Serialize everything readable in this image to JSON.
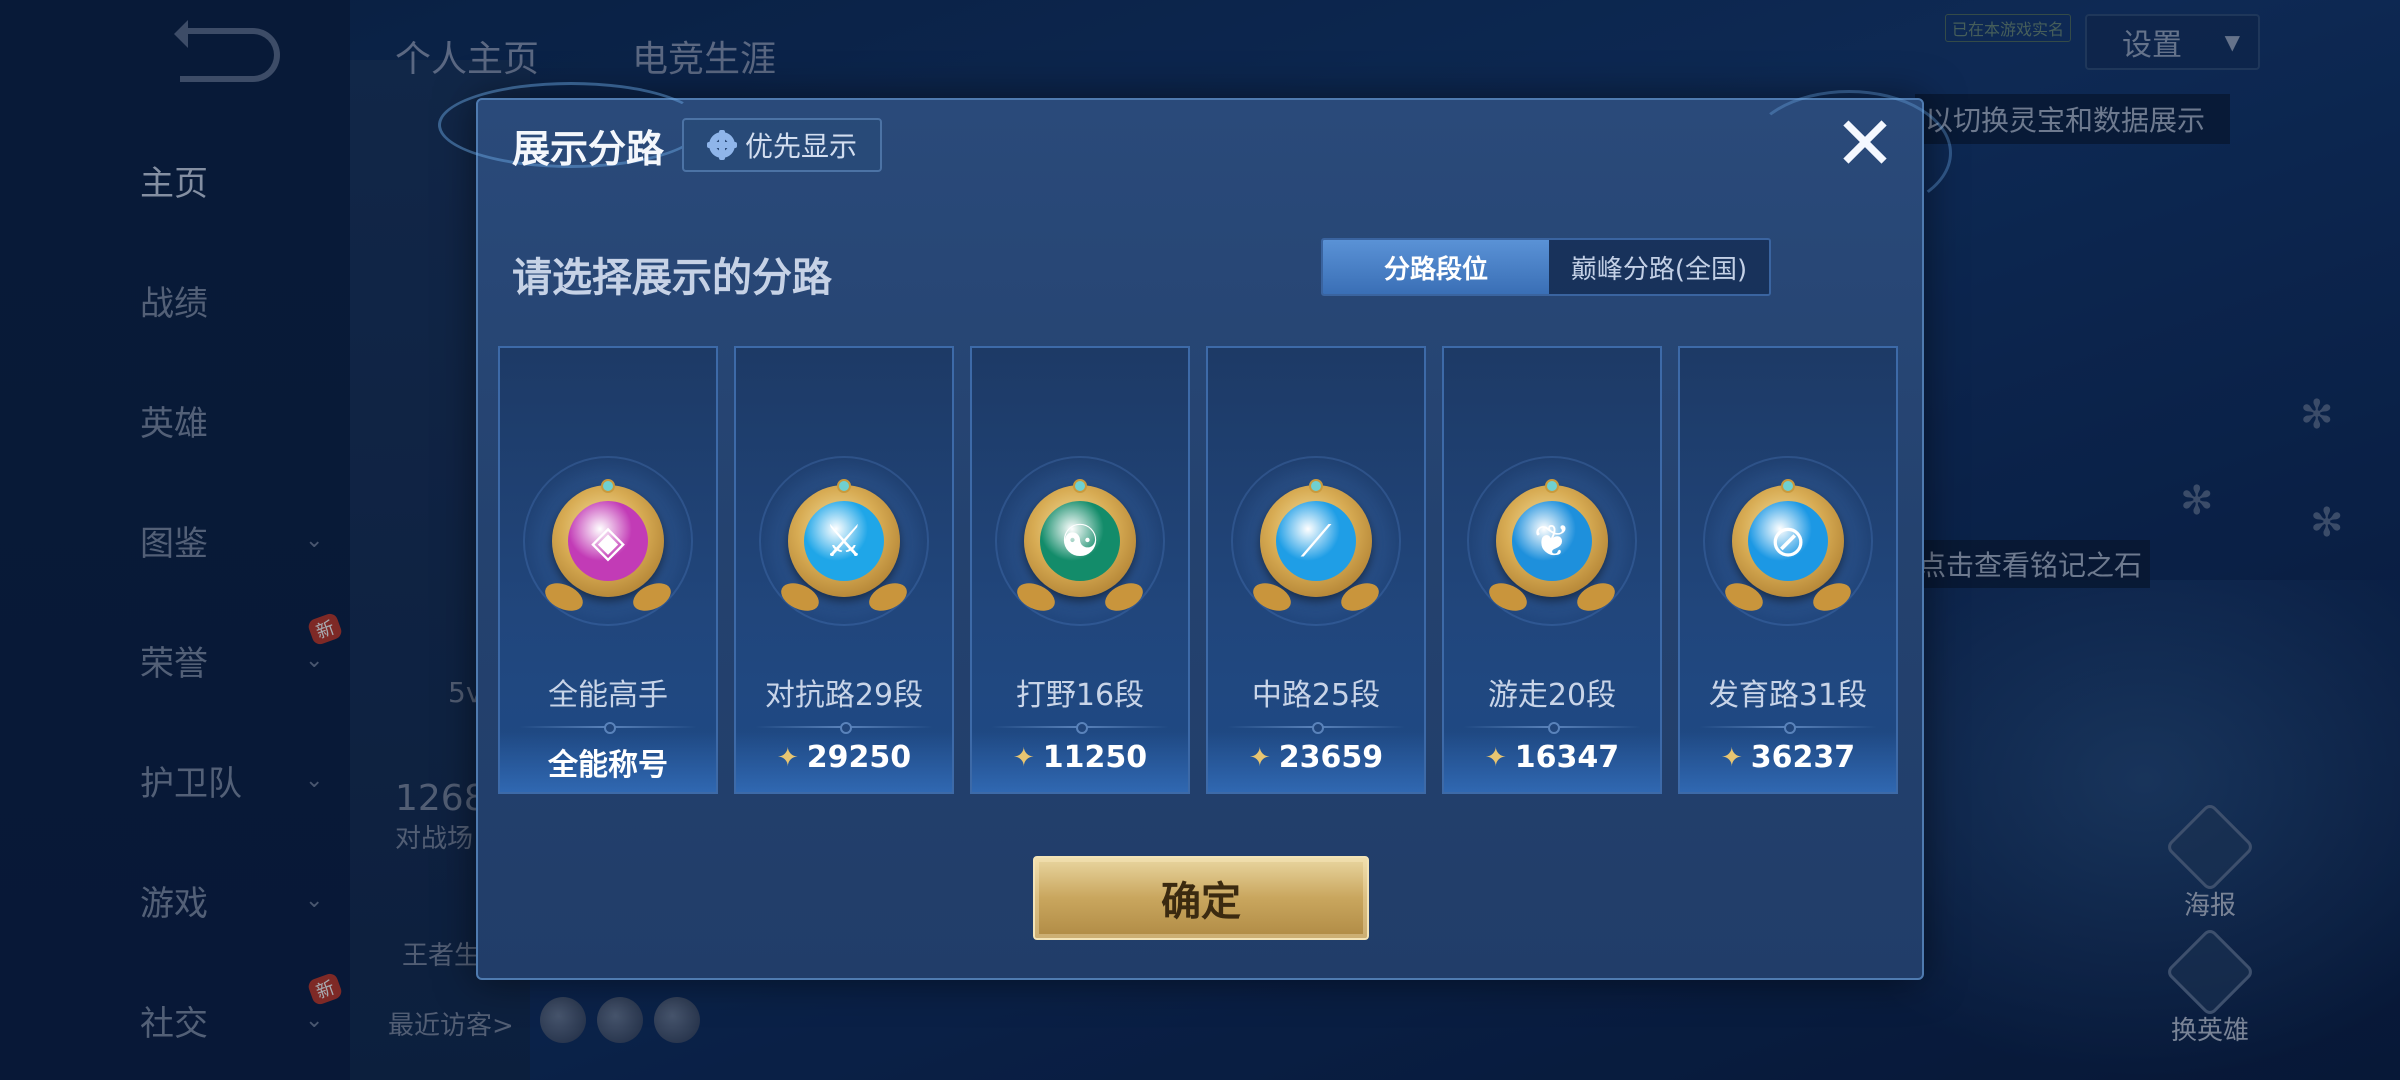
{
  "background": {
    "top_tabs": [
      "个人主页",
      "电竞生涯"
    ],
    "nav_items": [
      {
        "label": "主页",
        "active": true,
        "chevron": false,
        "new": false
      },
      {
        "label": "战绩",
        "active": false,
        "chevron": false,
        "new": false
      },
      {
        "label": "英雄",
        "active": false,
        "chevron": false,
        "new": false
      },
      {
        "label": "图鉴",
        "active": false,
        "chevron": true,
        "new": false
      },
      {
        "label": "荣誉",
        "active": false,
        "chevron": true,
        "new": true
      },
      {
        "label": "护卫队",
        "active": false,
        "chevron": true,
        "new": false
      },
      {
        "label": "游戏",
        "active": false,
        "chevron": true,
        "new": false
      },
      {
        "label": "社交",
        "active": false,
        "chevron": true,
        "new": true
      }
    ],
    "new_badge": "新",
    "settings_label": "设置",
    "small_tag": "已在本游戏实名",
    "tip_top": "以切换灵宝和数据展示",
    "tip_mid": "点击查看铭记之石",
    "stat_number": "1268",
    "stat_label": "对战场",
    "partial_5v": "5v",
    "partial_wangzhe": "王者生",
    "recent_visitors": "最近访客>",
    "right_buttons": [
      "海报",
      "换英雄"
    ]
  },
  "dialog": {
    "title": "展示分路",
    "priority_label": "优先显示",
    "close_symbol": "✕",
    "prompt": "请选择展示的分路",
    "toggle_options": [
      {
        "label": "分路段位",
        "selected": true
      },
      {
        "label": "巅峰分路(全国)",
        "selected": false
      }
    ],
    "cards": [
      {
        "title": "全能高手",
        "value": "全能称号",
        "show_points_icon": false,
        "emblem_color": "#c23bb6",
        "glyph": "◈"
      },
      {
        "title": "对抗路29段",
        "value": "29250",
        "show_points_icon": true,
        "emblem_color": "#1fa6e8",
        "glyph": "⚔"
      },
      {
        "title": "打野16段",
        "value": "11250",
        "show_points_icon": true,
        "emblem_color": "#138c6a",
        "glyph": "☯"
      },
      {
        "title": "中路25段",
        "value": "23659",
        "show_points_icon": true,
        "emblem_color": "#1f9ee6",
        "glyph": "⟋"
      },
      {
        "title": "游走20段",
        "value": "16347",
        "show_points_icon": true,
        "emblem_color": "#1e90dc",
        "glyph": "❦"
      },
      {
        "title": "发育路31段",
        "value": "36237",
        "show_points_icon": true,
        "emblem_color": "#1c98e4",
        "glyph": "⊘"
      }
    ],
    "confirm_label": "确定"
  }
}
